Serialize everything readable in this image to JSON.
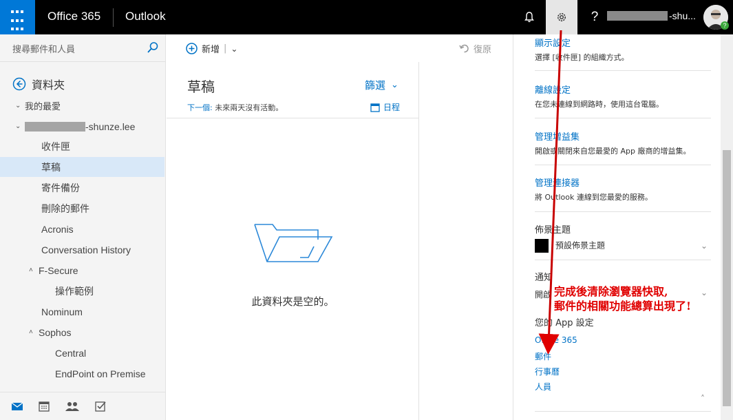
{
  "topbar": {
    "brand": "Office 365",
    "app": "Outlook",
    "help": "?",
    "user_suffix": "-shu..."
  },
  "search": {
    "placeholder": "搜尋郵件和人員"
  },
  "nav": {
    "folders_label": "資料夾",
    "favorites": "我的最愛",
    "account_suffix": "-shunze.lee",
    "items": [
      {
        "label": "收件匣"
      },
      {
        "label": "草稿"
      },
      {
        "label": "寄件備份"
      },
      {
        "label": "刪除的郵件"
      },
      {
        "label": "Acronis"
      },
      {
        "label": "Conversation History"
      },
      {
        "label": "F-Secure"
      },
      {
        "label": "操作範例"
      },
      {
        "label": "Nominum"
      },
      {
        "label": "Sophos"
      },
      {
        "label": "Central"
      },
      {
        "label": "EndPoint on Premise"
      }
    ],
    "selected": "草稿"
  },
  "commands": {
    "new": "新增",
    "undo": "復原"
  },
  "list": {
    "title": "草稿",
    "filter": "篩選",
    "next_label": "下一個:",
    "next_text": "未來兩天沒有活動。",
    "calendar": "日程",
    "empty": "此資料夾是空的。"
  },
  "settings": {
    "display": {
      "title": "顯示設定",
      "desc": "選擇 [收件匣] 的組織方式。"
    },
    "offline": {
      "title": "離線設定",
      "desc": "在您未連線到網路時，使用這台電腦。"
    },
    "addins": {
      "title": "管理增益集",
      "desc": "開啟或關閉來自您最愛的 App 廠商的增益集。"
    },
    "connectors": {
      "title": "管理連接器",
      "desc": "將 Outlook 連線到您最愛的服務。"
    },
    "theme": {
      "title": "佈景主題",
      "value": "預設佈景主題",
      "swatch_color": "#000000"
    },
    "notifications": {
      "title": "通知",
      "value": "開啟"
    },
    "app_settings": {
      "title": "您的 App 設定",
      "links": [
        "Office 365",
        "郵件",
        "行事曆",
        "人員"
      ]
    }
  },
  "annotation": {
    "line1": "完成後清除瀏覽器快取,",
    "line2": "郵件的相關功能總算出現了!",
    "color": "#e00000"
  },
  "colors": {
    "accent": "#0072c6",
    "waffle": "#0078d7",
    "selected_row": "#d8e8f8"
  }
}
